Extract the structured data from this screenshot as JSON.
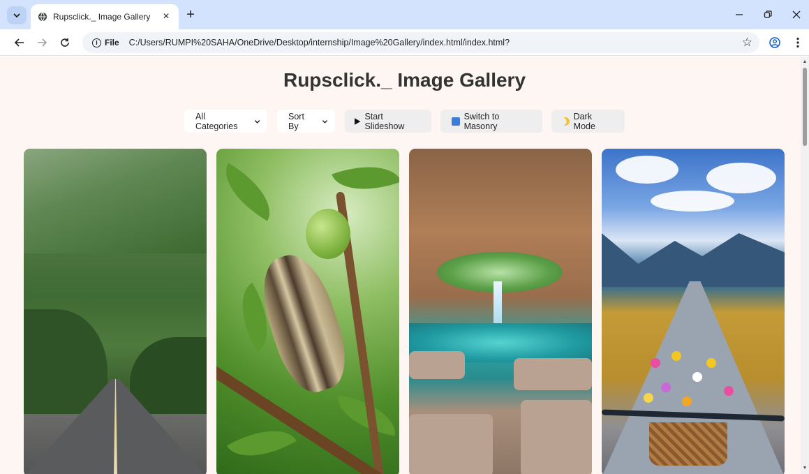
{
  "browser": {
    "tab_title": "Rupsclick._ Image Gallery",
    "new_tab": "+",
    "close_tab": "×",
    "url_scheme_label": "File",
    "url": "C:/Users/RUMPI%20SAHA/OneDrive/Desktop/internship/Image%20Gallery/index.html/index.html?",
    "window_controls": [
      "minimize",
      "restore",
      "close"
    ]
  },
  "page": {
    "title": "Rupsclick._ Image Gallery",
    "controls": {
      "category_select": "All Categories",
      "sort_select": "Sort By",
      "slideshow_button": "Start Slideshow",
      "masonry_button": "Switch to Masonry",
      "dark_mode_button": "Dark Mode"
    },
    "accent_color": "#3d7bd9",
    "background_color": "#fdf6f2"
  }
}
